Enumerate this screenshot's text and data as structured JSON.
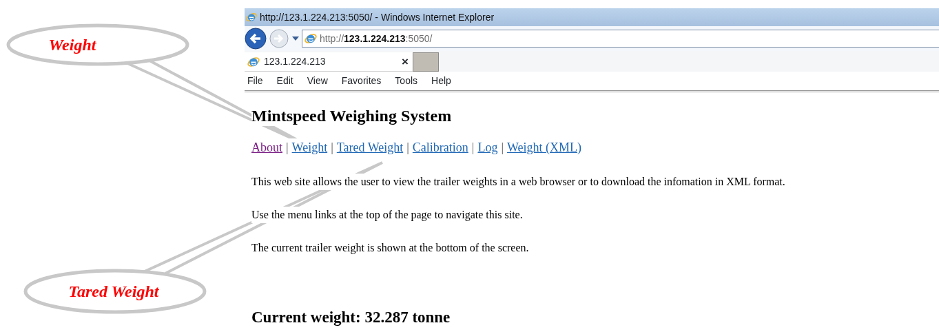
{
  "window": {
    "title": "http://123.1.224.213:5050/ - Windows Internet Explorer"
  },
  "address_bar": {
    "url": "http://**123.1.224.213**:5050/"
  },
  "tabs": [
    {
      "label": "123.1.224.213",
      "selected": true,
      "close": "×"
    }
  ],
  "menu": [
    "File",
    "Edit",
    "View",
    "Favorites",
    "Tools",
    "Help"
  ],
  "page": {
    "heading": "Mintspeed Weighing System",
    "nav": [
      {
        "label": "About",
        "visited": true
      },
      {
        "label": "Weight",
        "visited": false,
        "separator": "|"
      },
      {
        "label": "Tared Weight",
        "visited": false,
        "separator": "|"
      },
      {
        "label": "Calibration",
        "visited": false,
        "separator": "|"
      },
      {
        "label": "Log",
        "visited": false,
        "separator": "|"
      },
      {
        "label": "Weight (XML)",
        "visited": false,
        "separator": "|"
      }
    ],
    "paragraphs": [
      "This web site allows the user to view the trailer weights in a web browser or to download the infomation in XML format.",
      "Use the menu links at the top of the page to navigate this site.",
      "The current trailer weight is shown at the bottom of the screen."
    ],
    "current_weight": "Current weight: 32.287 tonne"
  },
  "callouts": [
    {
      "label": "Weight"
    },
    {
      "label": "Tared Weight"
    }
  ]
}
